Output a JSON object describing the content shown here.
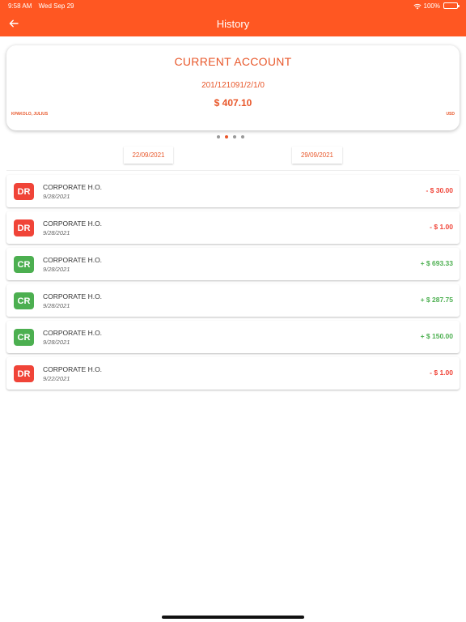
{
  "status_bar": {
    "time": "9:58 AM",
    "date": "Wed Sep 29",
    "battery": "100%"
  },
  "header": {
    "title": "History"
  },
  "account": {
    "name": "CURRENT ACCOUNT",
    "number": "201/121091/2/1/0",
    "balance": "$ 407.10",
    "holder": "KPAKOLO, JULIUS",
    "currency": "USD"
  },
  "pager": {
    "count": 4,
    "active_index": 1
  },
  "date_range": {
    "from": "22/09/2021",
    "to": "29/09/2021"
  },
  "colors": {
    "header": "#FF5722",
    "accent": "#E8572A",
    "debit": "#F04438",
    "credit": "#4CAF50"
  },
  "transactions": [
    {
      "type": "DR",
      "name": "CORPORATE H.O.",
      "date": "9/28/2021",
      "amount": "- $ 30.00"
    },
    {
      "type": "DR",
      "name": "CORPORATE H.O.",
      "date": "9/28/2021",
      "amount": "- $ 1.00"
    },
    {
      "type": "CR",
      "name": "CORPORATE H.O.",
      "date": "9/28/2021",
      "amount": "+ $ 693.33"
    },
    {
      "type": "CR",
      "name": "CORPORATE H.O.",
      "date": "9/28/2021",
      "amount": "+ $ 287.75"
    },
    {
      "type": "CR",
      "name": "CORPORATE H.O.",
      "date": "9/28/2021",
      "amount": "+ $ 150.00"
    },
    {
      "type": "DR",
      "name": "CORPORATE H.O.",
      "date": "9/22/2021",
      "amount": "- $ 1.00"
    }
  ]
}
